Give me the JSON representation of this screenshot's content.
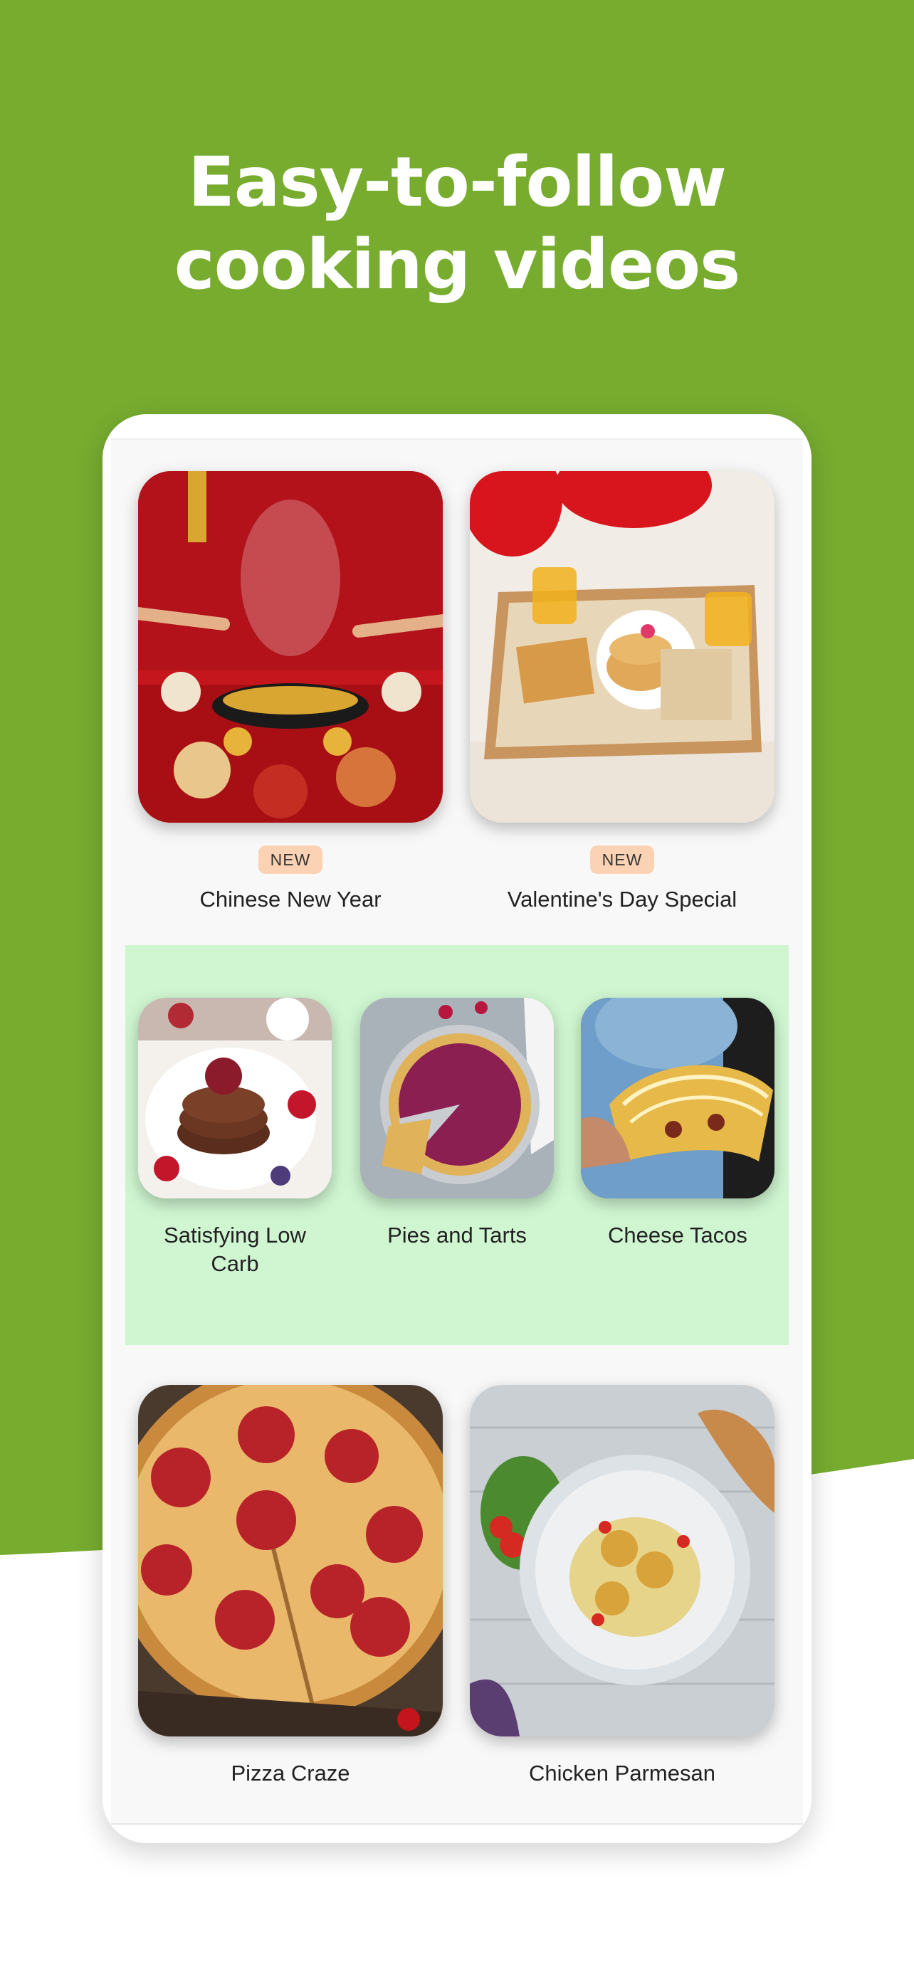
{
  "headline": {
    "line1": "Easy-to-follow",
    "line2": "cooking videos"
  },
  "colors": {
    "brand_green": "#77ac2f",
    "featured_band": "#cff6d1",
    "badge_bg": "#fbd3b4"
  },
  "rows": {
    "top": [
      {
        "title": "Chinese New Year",
        "badge": "NEW"
      },
      {
        "title": "Valentine's Day Special",
        "badge": "NEW"
      }
    ],
    "featured": [
      {
        "title": "Satisfying Low Carb"
      },
      {
        "title": "Pies and Tarts"
      },
      {
        "title": "Cheese Tacos"
      }
    ],
    "bottom": [
      {
        "title": "Pizza Craze"
      },
      {
        "title": "Chicken Parmesan"
      }
    ]
  }
}
